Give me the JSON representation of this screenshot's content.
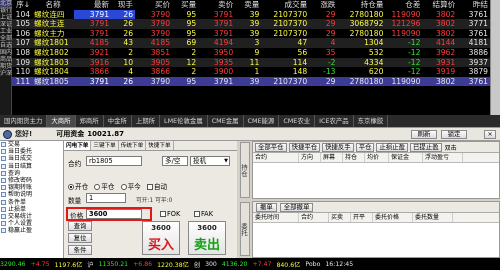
{
  "side_strip": [
    "北京",
    "银行",
    "上证",
    "深证",
    "工业",
    "全部",
    "自选",
    "国内",
    "商品",
    "期货",
    "沪深"
  ],
  "quote": {
    "headers": [
      "序↓",
      "名称",
      "最新",
      "现手",
      "买价",
      "买量",
      "卖价",
      "卖量",
      "成交量",
      "涨跌",
      "持仓量",
      "仓差",
      "结算价",
      "昨结"
    ],
    "rows": [
      [
        "104",
        "螺纹连四",
        "3791",
        "26",
        "3790",
        "95",
        "3791",
        "39",
        "2107370",
        "29",
        "2780180",
        "119090",
        "3802",
        "3761"
      ],
      [
        "105",
        "螺纹主连",
        "3791",
        "26",
        "3790",
        "95",
        "3791",
        "39",
        "2107370",
        "29",
        "3068792",
        "121296",
        "3802",
        "3771"
      ],
      [
        "106",
        "螺纹主力",
        "3791",
        "26",
        "3790",
        "95",
        "3791",
        "39",
        "2107370",
        "29",
        "2780180",
        "119090",
        "3802",
        "3761"
      ],
      [
        "107",
        "螺纹1801",
        "4185",
        "43",
        "4185",
        "69",
        "4194",
        "3",
        "47",
        "4",
        "1304",
        "-12",
        "4144",
        "4181"
      ],
      [
        "108",
        "螺纹1802",
        "3921",
        "2",
        "3851",
        "2",
        "3950",
        "9",
        "56",
        "35",
        "532",
        "-12",
        "3962",
        "3886"
      ],
      [
        "109",
        "螺纹1803",
        "3916",
        "10",
        "3905",
        "12",
        "3935",
        "11",
        "114",
        "-2",
        "4334",
        "-12",
        "3931",
        "3937"
      ],
      [
        "110",
        "螺纹1804",
        "3866",
        "4",
        "3866",
        "2",
        "3900",
        "1",
        "148",
        "-13",
        "620",
        "-12",
        "3919",
        "3879"
      ],
      [
        "111",
        "螺纹1805",
        "3791",
        "26",
        "3790",
        "95",
        "3791",
        "39",
        "2107370",
        "29",
        "2780180",
        "119090",
        "3802",
        "3761"
      ]
    ]
  },
  "tabs": [
    "国内期货主力",
    "大商所",
    "郑商所",
    "中金所",
    "上期所",
    "LME伦敦金属",
    "CME金属",
    "CME能源",
    "CME农业",
    "ICE农产品",
    "东京橡胶"
  ],
  "account": {
    "greeting": "您好!",
    "funds_label": "可用资金",
    "funds_value": "10021.87",
    "refresh": "刷新",
    "lock": "锁定",
    "close": "×"
  },
  "tree": [
    "交易",
    "当日委托",
    "当日成交",
    "当日结算",
    "查询",
    "修改密码",
    "银期转账",
    "帮助说明",
    "条件单",
    "止损单",
    "交易统计",
    "个人设置",
    "稳赢止盈"
  ],
  "form": {
    "tabs": [
      "闪电下单",
      "三键下单",
      "传统下单",
      "快捷下单"
    ],
    "contract_label": "合约",
    "contract_value": "rb1805",
    "direction_value": "多/空",
    "hedge_value": "投机",
    "open": "开仓",
    "close_pos": "平仓",
    "close_today": "平今",
    "auto": "自动",
    "qty_label": "数量",
    "qty_value": "1",
    "open_info": "可开:1  可平:0",
    "price_label": "价格",
    "price_value": "3600",
    "fok": "FOK",
    "fak": "FAK",
    "small_btns": [
      "查询",
      "复位",
      "条件"
    ],
    "buy_price": "3600",
    "buy_label": "买入",
    "sell_price": "3600",
    "sell_label": "卖出"
  },
  "positions": {
    "vtab": "持仓",
    "buttons": [
      "全部平仓",
      "快捷平仓",
      "快捷反手",
      "平仓",
      "止损止盈",
      "已提止盈"
    ],
    "extra": "双击",
    "columns": [
      "合约",
      "方向",
      "屏幕",
      "持仓",
      "均价",
      "保证金",
      "浮动盈亏"
    ]
  },
  "orders": {
    "vtab": "委托",
    "buttons": [
      "撤单",
      "全部撤单"
    ],
    "columns": [
      "委托时间",
      "合约",
      "买卖",
      "开平",
      "委托价格",
      "委托数量"
    ]
  },
  "status": [
    [
      "3290.46",
      "grn"
    ],
    [
      "+4.75",
      "red"
    ],
    [
      "1197.6亿",
      "yel"
    ],
    [
      "沪",
      "wht"
    ],
    [
      "11350.21",
      "grn"
    ],
    [
      "+6.86",
      "red"
    ],
    [
      "1220.38亿",
      "yel"
    ],
    [
      "创",
      "wht"
    ],
    [
      "300",
      "wht"
    ],
    [
      "4136.20",
      "grn"
    ],
    [
      "+7.47",
      "red"
    ],
    [
      "840.6亿",
      "yel"
    ],
    [
      "Pobo",
      "wht"
    ],
    [
      "16:12:45",
      "wht"
    ]
  ]
}
